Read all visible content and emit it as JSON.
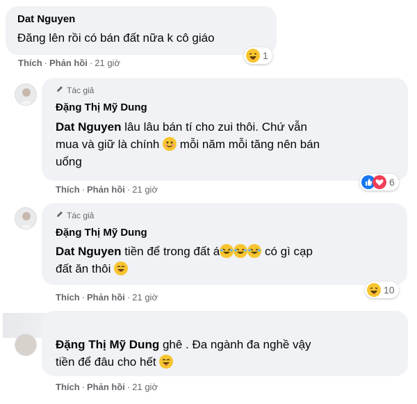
{
  "comments": [
    {
      "name": "Dat Nguyen",
      "text": "Đăng lên rồi có bán đất nữa k cô giáo",
      "actions": {
        "like": "Thích",
        "reply": "Phản hồi",
        "time": "21 giờ"
      },
      "reactions": {
        "icon": "haha-icon",
        "count": "1"
      }
    },
    {
      "badge": "Tác giả",
      "name": "Đặng Thị Mỹ Dung",
      "mention": "Dat Nguyen",
      "text_line1": " lâu lâu bán tí cho zui thôi. Chứ vẫn",
      "text_line2a": "mua và giữ là chính ",
      "text_line2b": " mỗi năm mỗi tăng nên bán",
      "text_line3": "uổng",
      "actions": {
        "like": "Thích",
        "reply": "Phản hồi",
        "time": "21 giờ"
      },
      "reactions": {
        "icons": [
          "like-icon",
          "love-icon"
        ],
        "count": "6"
      }
    },
    {
      "badge": "Tác giả",
      "name": "Đặng Thị Mỹ Dung",
      "mention": "Dat Nguyen",
      "text_line1": " tiền để trong đất á",
      "text_line1b": " có gì cạp",
      "text_line2": "đất ăn thôi ",
      "actions": {
        "like": "Thích",
        "reply": "Phản hồi",
        "time": "21 giờ"
      },
      "reactions": {
        "icon": "haha-icon",
        "count": "10"
      }
    },
    {
      "name": "Đặng Thị Mỹ Dung",
      "text_line1": " ghê . Đa ngành đa nghề vậy",
      "text_line2": "tiền để đâu cho hết ",
      "actions": {
        "like": "Thích",
        "reply": "Phản hồi",
        "time": "21 giờ"
      }
    }
  ],
  "colors": {
    "bubble": "#f0f2f5",
    "meta": "#65676b",
    "text": "#050505"
  }
}
